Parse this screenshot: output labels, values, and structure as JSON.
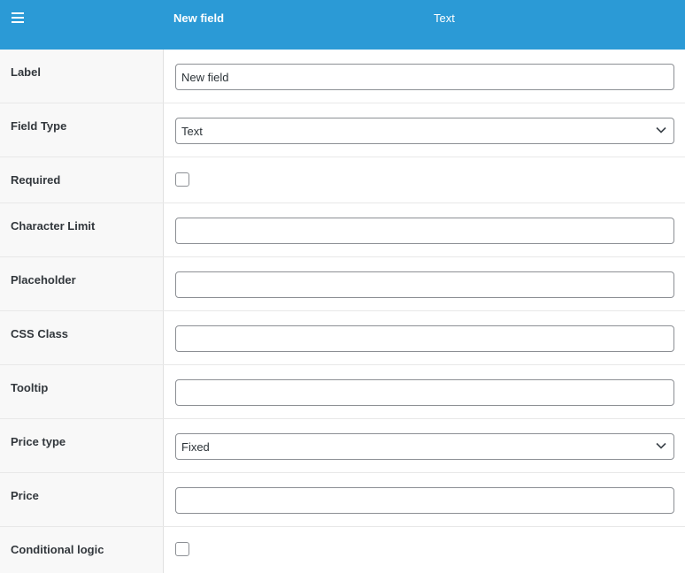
{
  "header": {
    "title": "New field",
    "type_label": "Text"
  },
  "fields": {
    "label": {
      "label": "Label",
      "value": "New field"
    },
    "field_type": {
      "label": "Field Type",
      "selected": "Text"
    },
    "required": {
      "label": "Required",
      "checked": false
    },
    "character_limit": {
      "label": "Character Limit",
      "value": ""
    },
    "placeholder": {
      "label": "Placeholder",
      "value": ""
    },
    "css_class": {
      "label": "CSS Class",
      "value": ""
    },
    "tooltip": {
      "label": "Tooltip",
      "value": ""
    },
    "price_type": {
      "label": "Price type",
      "selected": "Fixed"
    },
    "price": {
      "label": "Price",
      "value": ""
    },
    "conditional_logic": {
      "label": "Conditional logic",
      "checked": false
    }
  },
  "colors": {
    "header_bg": "#2b9ad6",
    "label_column_bg": "#f8f8f8",
    "input_border": "#8c8f94"
  }
}
